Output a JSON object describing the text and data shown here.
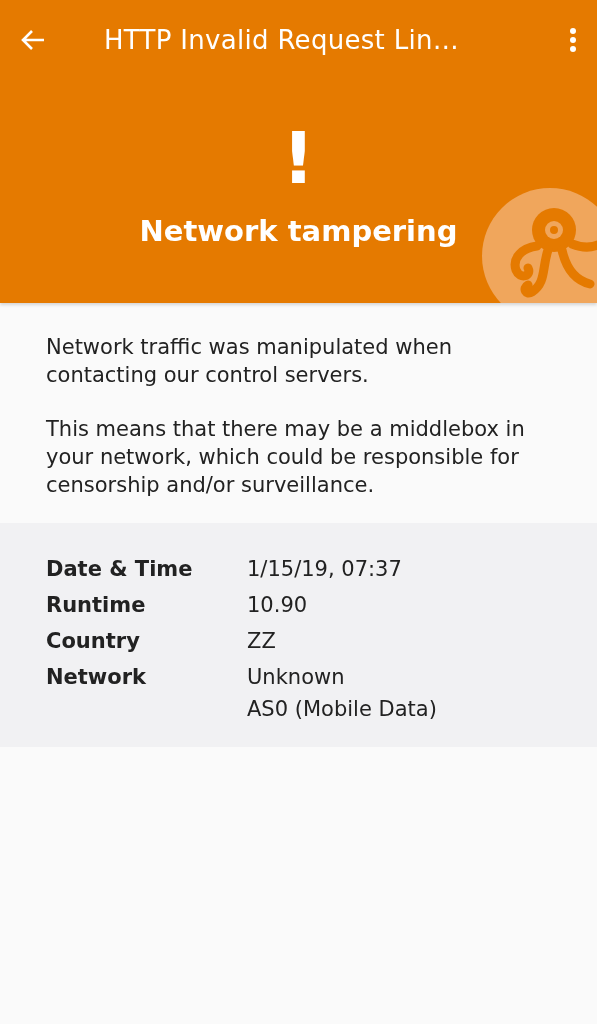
{
  "app_bar": {
    "title": "HTTP Invalid Request Lin…"
  },
  "header": {
    "glyph": "!",
    "heading": "Network tampering"
  },
  "description": [
    "Network traffic was manipulated when contacting our control servers.",
    "This means that there may be a middlebox in your network, which could be responsible for censorship and/or surveillance."
  ],
  "details": [
    {
      "label": "Date & Time",
      "values": [
        "1/15/19, 07:37"
      ]
    },
    {
      "label": "Runtime",
      "values": [
        "10.90"
      ]
    },
    {
      "label": "Country",
      "values": [
        "ZZ"
      ]
    },
    {
      "label": "Network",
      "values": [
        "Unknown",
        "AS0 (Mobile Data)"
      ]
    }
  ]
}
